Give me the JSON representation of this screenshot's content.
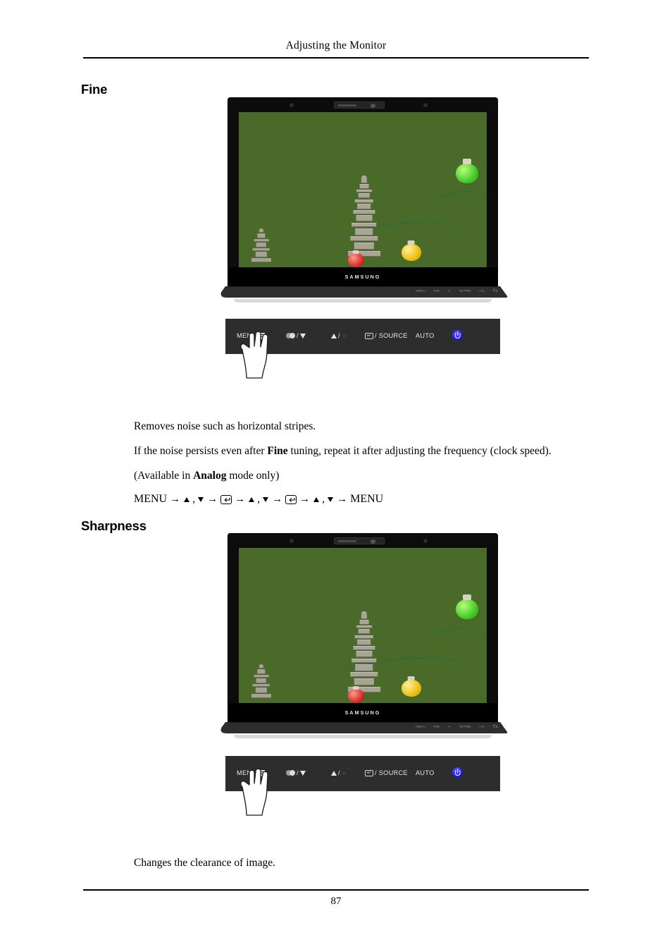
{
  "header": {
    "title": "Adjusting the Monitor"
  },
  "sections": [
    {
      "heading": "Fine",
      "paragraphs": [
        "Removes noise such as horizontal stripes.",
        "If the noise persists even after ",
        "(Available in ",
        "Changes the clearance of image."
      ]
    }
  ],
  "fine": {
    "heading": "Fine",
    "desc_1": "Removes noise such as horizontal stripes.",
    "desc_2_a": "If the noise persists even after ",
    "desc_2_b": "Fine",
    "desc_2_c": " tuning, repeat it after adjusting the frequency (clock speed).",
    "desc_3_a": "(Available in ",
    "desc_3_b": "Analog",
    "desc_3_c": " mode only)",
    "nav": {
      "start": "MENU",
      "end": "MENU",
      "arrow": "→",
      "comma": ","
    }
  },
  "sharpness": {
    "heading": "Sharpness",
    "desc_1": "Changes the clearance of image."
  },
  "monitor": {
    "brand": "SAMSUNG",
    "stand_labels": [
      "MENU",
      "M/B",
      "+/-",
      "ENTER",
      "A/S"
    ]
  },
  "controls": {
    "menu_label": "MENU",
    "menu_icon": "menu-grid-icon",
    "magicbright_icon": "magicbright-icon",
    "down_label": "/",
    "down_icon": "triangle-down-icon",
    "up_icon": "triangle-up-icon",
    "brightness_label": "/",
    "brightness_icon": "sun-icon",
    "enter_icon": "enter-key-icon",
    "source_label": "/ SOURCE",
    "auto_label": "AUTO",
    "power_icon": "power-icon"
  },
  "footer": {
    "page_number": "87"
  },
  "colors": {
    "power_blue": "#2a22e0",
    "control_bar": "#2d2d2d",
    "bezel": "#0c0c0c"
  }
}
